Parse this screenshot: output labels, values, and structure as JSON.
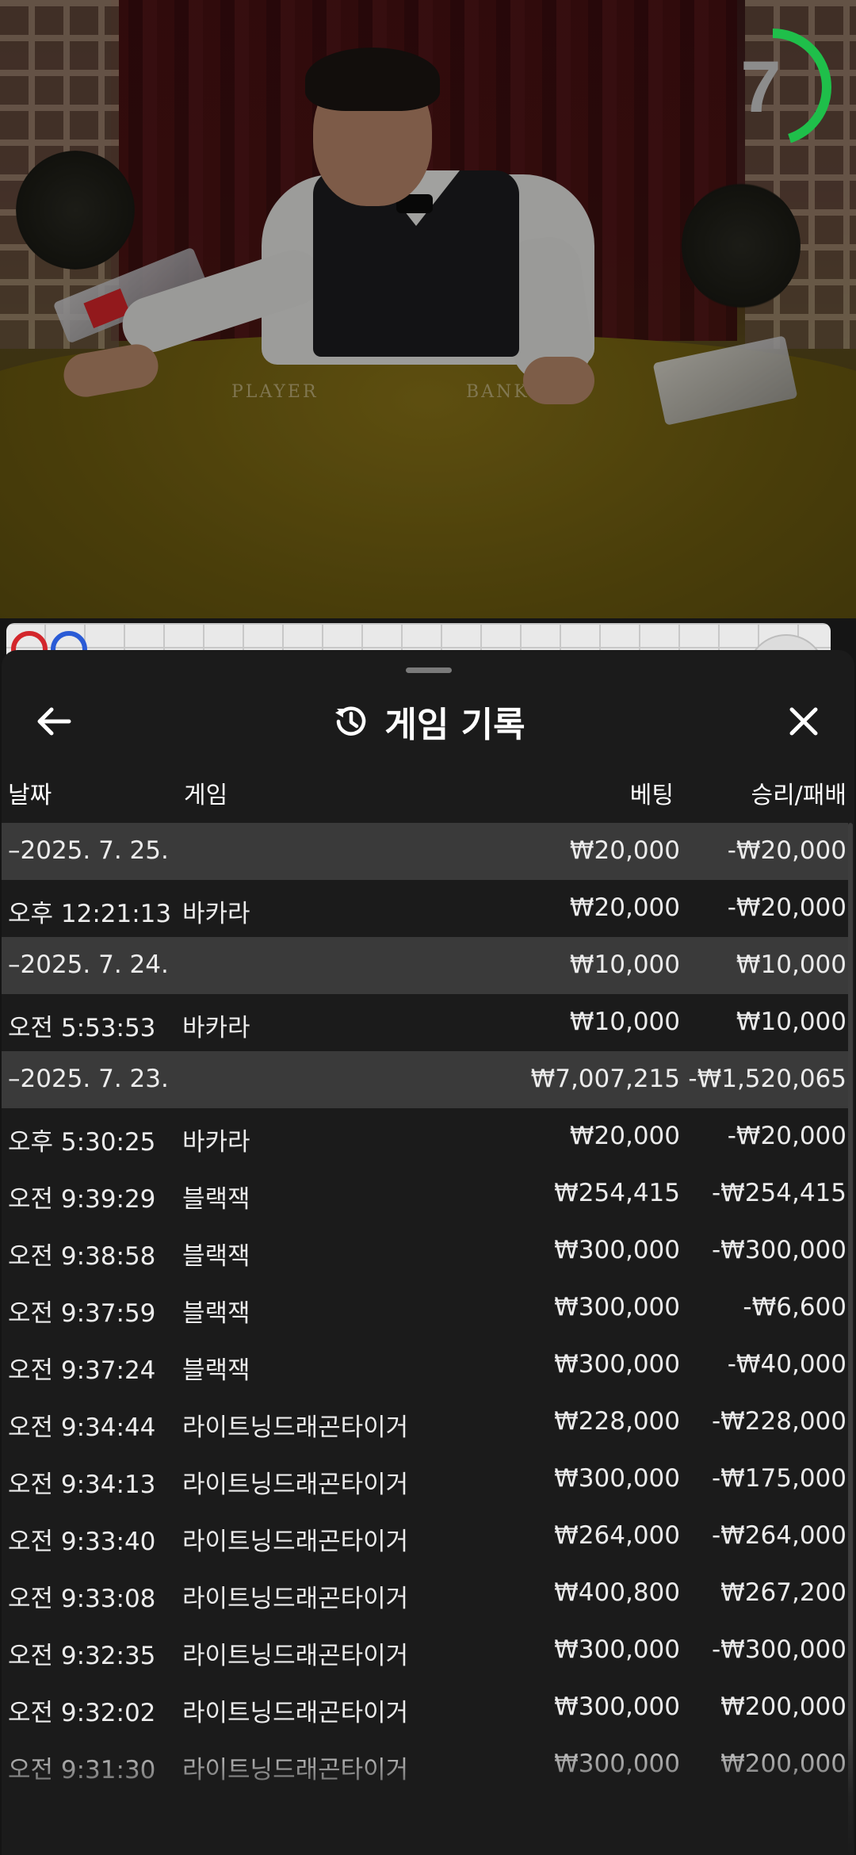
{
  "video": {
    "table_player_label": "PLAYER",
    "table_banker_label": "BANKER",
    "countdown": "7",
    "countdown_color": "#1fbf4a",
    "countdown_fraction": 0.45
  },
  "sheet": {
    "back_icon": "arrow-left-icon",
    "history_icon": "history-icon",
    "close_icon": "close-icon",
    "title": "게임 기록",
    "columns": {
      "date": "날짜",
      "game": "게임",
      "bet": "베팅",
      "result": "승리/패배"
    },
    "rows": [
      {
        "type": "group",
        "date": "–2025. 7. 25.",
        "game": "",
        "bet": "₩20,000",
        "result": "-₩20,000"
      },
      {
        "type": "item",
        "date": "오후 12:21:13",
        "game": "바카라",
        "bet": "₩20,000",
        "result": "-₩20,000"
      },
      {
        "type": "group",
        "date": "–2025. 7. 24.",
        "game": "",
        "bet": "₩10,000",
        "result": "₩10,000"
      },
      {
        "type": "item",
        "date": "오전 5:53:53",
        "game": "바카라",
        "bet": "₩10,000",
        "result": "₩10,000"
      },
      {
        "type": "group",
        "date": "–2025. 7. 23.",
        "game": "",
        "bet": "₩7,007,215",
        "result": "-₩1,520,065"
      },
      {
        "type": "item",
        "date": "오후 5:30:25",
        "game": "바카라",
        "bet": "₩20,000",
        "result": "-₩20,000"
      },
      {
        "type": "item",
        "date": "오전 9:39:29",
        "game": "블랙잭",
        "bet": "₩254,415",
        "result": "-₩254,415"
      },
      {
        "type": "item",
        "date": "오전 9:38:58",
        "game": "블랙잭",
        "bet": "₩300,000",
        "result": "-₩300,000"
      },
      {
        "type": "item",
        "date": "오전 9:37:59",
        "game": "블랙잭",
        "bet": "₩300,000",
        "result": "-₩6,600"
      },
      {
        "type": "item",
        "date": "오전 9:37:24",
        "game": "블랙잭",
        "bet": "₩300,000",
        "result": "-₩40,000"
      },
      {
        "type": "item",
        "date": "오전 9:34:44",
        "game": "라이트닝드래곤타이거",
        "bet": "₩228,000",
        "result": "-₩228,000"
      },
      {
        "type": "item",
        "date": "오전 9:34:13",
        "game": "라이트닝드래곤타이거",
        "bet": "₩300,000",
        "result": "-₩175,000"
      },
      {
        "type": "item",
        "date": "오전 9:33:40",
        "game": "라이트닝드래곤타이거",
        "bet": "₩264,000",
        "result": "-₩264,000"
      },
      {
        "type": "item",
        "date": "오전 9:33:08",
        "game": "라이트닝드래곤타이거",
        "bet": "₩400,800",
        "result": "₩267,200"
      },
      {
        "type": "item",
        "date": "오전 9:32:35",
        "game": "라이트닝드래곤타이거",
        "bet": "₩300,000",
        "result": "-₩300,000"
      },
      {
        "type": "item",
        "date": "오전 9:32:02",
        "game": "라이트닝드래곤타이거",
        "bet": "₩300,000",
        "result": "₩200,000"
      },
      {
        "type": "item",
        "date": "오전 9:31:30",
        "game": "라이트닝드래곤타이거",
        "bet": "₩300,000",
        "result": "₩200,000"
      }
    ]
  },
  "roadmap": {
    "beads": [
      {
        "color": "#d3262b"
      },
      {
        "color": "#2a5bd6"
      }
    ]
  }
}
